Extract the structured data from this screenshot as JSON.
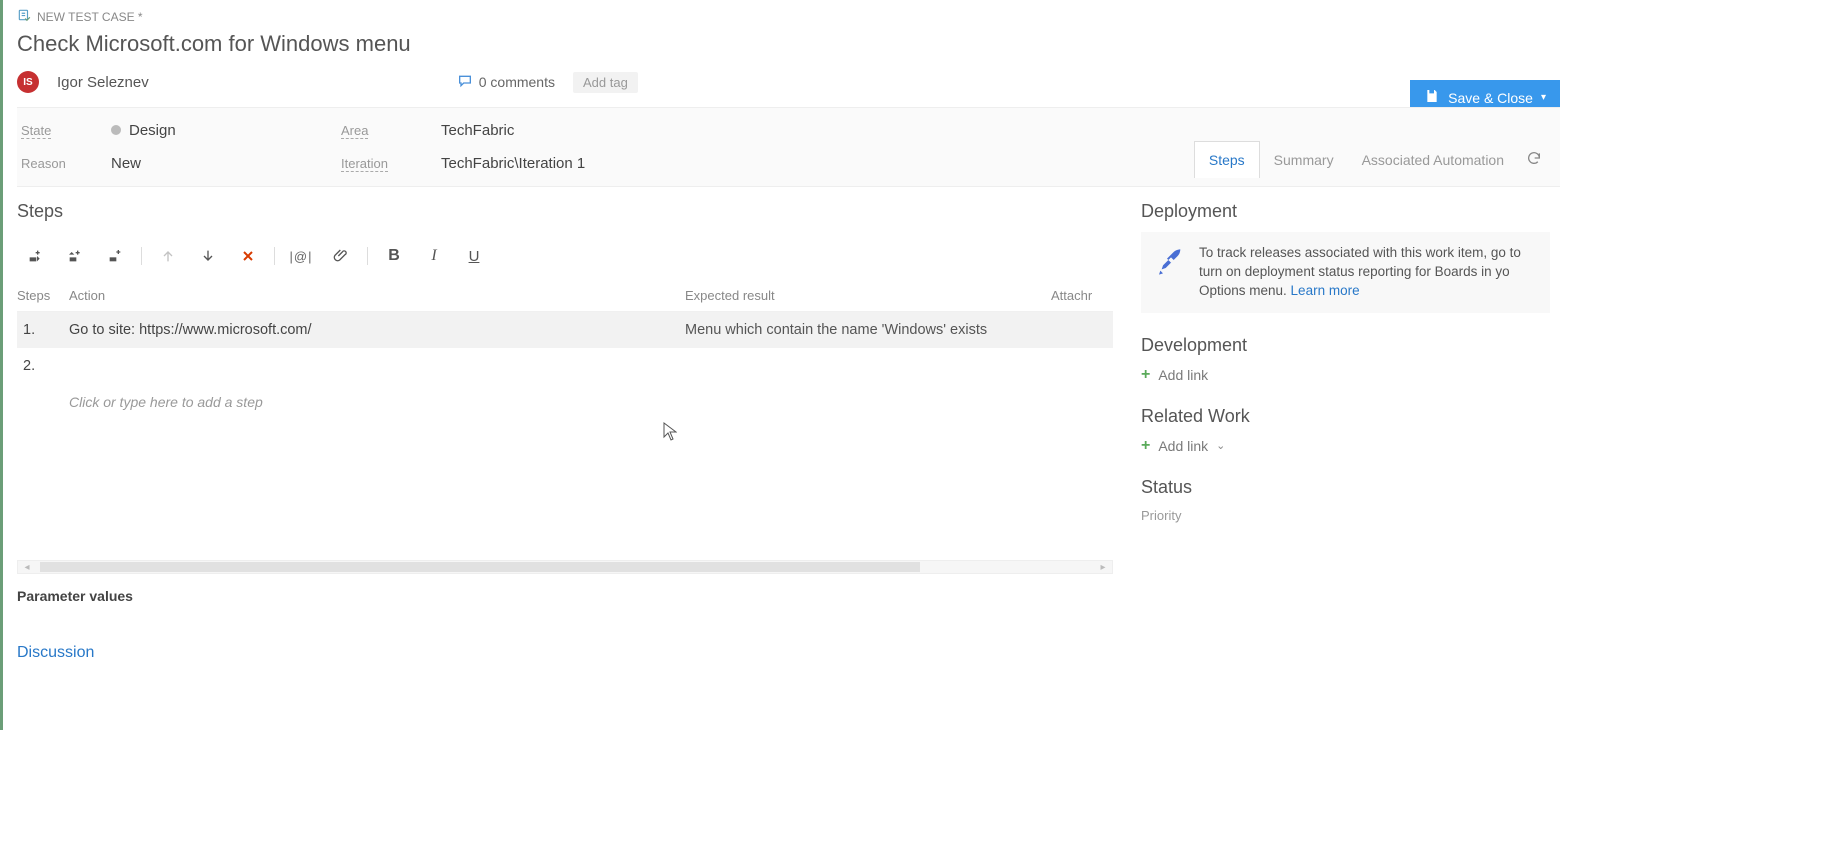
{
  "breadcrumb": {
    "label": "NEW TEST CASE *"
  },
  "title": "Check Microsoft.com for Windows menu",
  "assigned": {
    "initials": "IS",
    "name": "Igor Seleznev"
  },
  "comments": {
    "count": "0 comments"
  },
  "add_tag": "Add tag",
  "save_button": "Save & Close",
  "fields": {
    "state_label": "State",
    "state_value": "Design",
    "reason_label": "Reason",
    "reason_value": "New",
    "area_label": "Area",
    "area_value": "TechFabric",
    "iteration_label": "Iteration",
    "iteration_value": "TechFabric\\Iteration 1"
  },
  "tabs": {
    "steps": "Steps",
    "summary": "Summary",
    "automation": "Associated Automation"
  },
  "steps_section": {
    "heading": "Steps",
    "columns": {
      "steps": "Steps",
      "action": "Action",
      "expected": "Expected result",
      "attach": "Attachr"
    },
    "rows": [
      {
        "num": "1.",
        "action": "Go to site: https://www.microsoft.com/",
        "expected": "Menu which contain the name 'Windows' exists"
      },
      {
        "num": "2.",
        "action": "",
        "expected": ""
      }
    ],
    "placeholder": "Click or type here to add a step"
  },
  "param_heading": "Parameter values",
  "discussion_heading": "Discussion",
  "right": {
    "deployment": {
      "heading": "Deployment",
      "info_text": "To track releases associated with this work item, go to turn on deployment status reporting for Boards in yo Options menu. ",
      "learn_more": "Learn more"
    },
    "development": {
      "heading": "Development",
      "add_link": "Add link"
    },
    "related": {
      "heading": "Related Work",
      "add_link": "Add link"
    },
    "status": {
      "heading": "Status",
      "priority_label": "Priority"
    }
  }
}
